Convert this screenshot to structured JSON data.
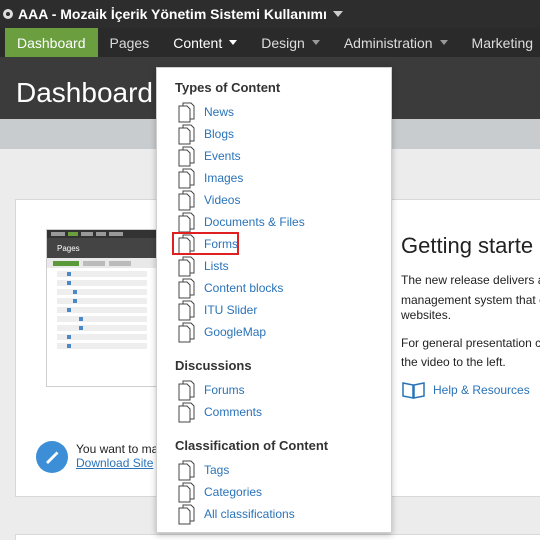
{
  "app": {
    "title": "AAA - Mozaik İçerik Yönetim Sistemi Kullanımı"
  },
  "nav": {
    "items": [
      {
        "label": "Dashboard",
        "active": true
      },
      {
        "label": "Pages"
      },
      {
        "label": "Content",
        "open": true
      },
      {
        "label": "Design"
      },
      {
        "label": "Administration"
      },
      {
        "label": "Marketing"
      }
    ]
  },
  "header": {
    "title": "Dashboard"
  },
  "main": {
    "heading": "Getting starte",
    "paragraph1": [
      "The new release delivers a",
      "management system that c",
      "websites."
    ],
    "paragraph2": [
      "For general presentation c",
      "the video to the left."
    ],
    "help_link": "Help & Resources",
    "want_text": "You want to ma",
    "download_link": "Download Site"
  },
  "thumbnail": {
    "header": "Pages"
  },
  "dropdown": {
    "sections": [
      {
        "title": "Types of Content",
        "items": [
          "News",
          "Blogs",
          "Events",
          "Images",
          "Videos",
          "Documents & Files",
          "Forms",
          "Lists",
          "Content blocks",
          "ITU Slider",
          "GoogleMap"
        ]
      },
      {
        "title": "Discussions",
        "items": [
          "Forums",
          "Comments"
        ]
      },
      {
        "title": "Classification of Content",
        "items": [
          "Tags",
          "Categories",
          "All classifications"
        ]
      }
    ],
    "highlighted_item": "Forms"
  },
  "colors": {
    "accent": "#6a9e3f",
    "link": "#2a73b8",
    "highlight": "#e02020"
  }
}
